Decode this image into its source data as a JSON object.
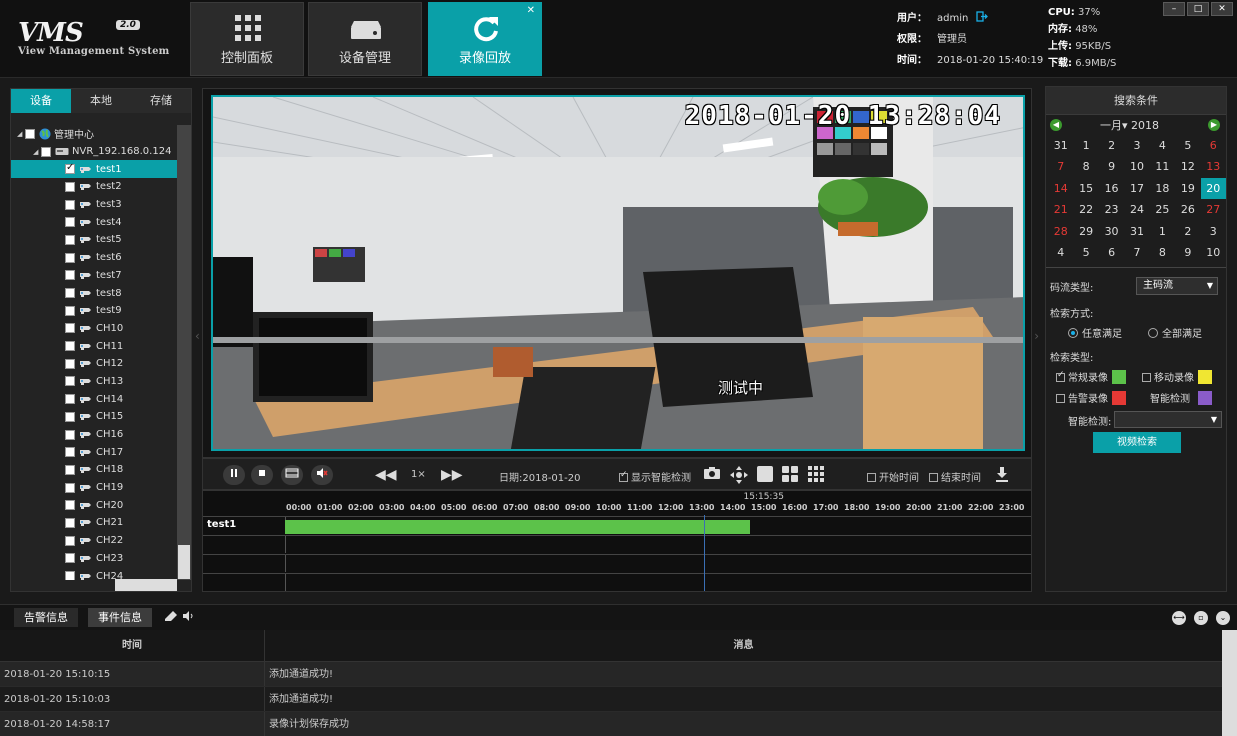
{
  "header": {
    "logo_main": "VMS",
    "logo_version": "2.0",
    "logo_sub": "View Management System",
    "nav": [
      {
        "label": "控制面板",
        "icon": "grid-icon",
        "active": false
      },
      {
        "label": "设备管理",
        "icon": "device-icon",
        "active": false
      },
      {
        "label": "录像回放",
        "icon": "refresh-icon",
        "active": true
      }
    ],
    "close_glyph": "✕",
    "user_label": "用户：",
    "user_value": "admin",
    "perm_label": "权限：",
    "perm_value": "管理员",
    "time_label": "时间：",
    "time_value": "2018-01-20 15:40:19",
    "cpu_label": "CPU:",
    "cpu_value": "37%",
    "mem_label": "内存:",
    "mem_value": "48%",
    "up_label": "上传:",
    "up_value": "95KB/S",
    "down_label": "下载:",
    "down_value": "6.9MB/S",
    "win_buttons": [
      "–",
      "□",
      "✕"
    ]
  },
  "left": {
    "tabs": [
      "设备",
      "本地",
      "存储"
    ],
    "root": "管理中心",
    "nvr": "NVR_192.168.0.124",
    "channels": [
      "test1",
      "test2",
      "test3",
      "test4",
      "test5",
      "test6",
      "test7",
      "test8",
      "test9",
      "CH10",
      "CH11",
      "CH12",
      "CH13",
      "CH14",
      "CH15",
      "CH16",
      "CH17",
      "CH18",
      "CH19",
      "CH20",
      "CH21",
      "CH22",
      "CH23",
      "CH24"
    ],
    "selected": "test1"
  },
  "video": {
    "osd_time": "2018-01-20 13:28:04",
    "osd_text": "测试中"
  },
  "controls": {
    "speed": "1×",
    "date_label": "日期:2018-01-20",
    "show_smart": "显示智能检测",
    "start_time": "开始时间",
    "end_time": "结束时间"
  },
  "timeline": {
    "current": "15:15:35",
    "hours": [
      "00:00",
      "01:00",
      "02:00",
      "03:00",
      "04:00",
      "05:00",
      "06:00",
      "07:00",
      "08:00",
      "09:00",
      "10:00",
      "11:00",
      "12:00",
      "13:00",
      "14:00",
      "15:00",
      "16:00",
      "17:00",
      "18:00",
      "19:00",
      "20:00",
      "21:00",
      "22:00",
      "23:00"
    ],
    "rows": [
      "test1",
      "",
      "",
      ""
    ],
    "record_start_hour": 0,
    "record_end_hour": 15.0,
    "cursor_hour": 13.5
  },
  "search": {
    "title": "搜索条件",
    "month": "一月",
    "year": "2018",
    "days": [
      {
        "d": "31",
        "red": false
      },
      {
        "d": "1",
        "red": false
      },
      {
        "d": "2",
        "red": false
      },
      {
        "d": "3",
        "red": false
      },
      {
        "d": "4",
        "red": false
      },
      {
        "d": "5",
        "red": false
      },
      {
        "d": "6",
        "red": true
      },
      {
        "d": "7",
        "red": true
      },
      {
        "d": "8",
        "red": false
      },
      {
        "d": "9",
        "red": false
      },
      {
        "d": "10",
        "red": false
      },
      {
        "d": "11",
        "red": false
      },
      {
        "d": "12",
        "red": false
      },
      {
        "d": "13",
        "red": true
      },
      {
        "d": "14",
        "red": true
      },
      {
        "d": "15",
        "red": false
      },
      {
        "d": "16",
        "red": false
      },
      {
        "d": "17",
        "red": false
      },
      {
        "d": "18",
        "red": false
      },
      {
        "d": "19",
        "red": false
      },
      {
        "d": "20",
        "red": false,
        "sel": true
      },
      {
        "d": "21",
        "red": true
      },
      {
        "d": "22",
        "red": false
      },
      {
        "d": "23",
        "red": false
      },
      {
        "d": "24",
        "red": false
      },
      {
        "d": "25",
        "red": false
      },
      {
        "d": "26",
        "red": false
      },
      {
        "d": "27",
        "red": true
      },
      {
        "d": "28",
        "red": true
      },
      {
        "d": "29",
        "red": false
      },
      {
        "d": "30",
        "red": false
      },
      {
        "d": "31",
        "red": false
      },
      {
        "d": "1",
        "red": false
      },
      {
        "d": "2",
        "red": false
      },
      {
        "d": "3",
        "red": false
      },
      {
        "d": "4",
        "red": false
      },
      {
        "d": "5",
        "red": false
      },
      {
        "d": "6",
        "red": false
      },
      {
        "d": "7",
        "red": false
      },
      {
        "d": "8",
        "red": false
      },
      {
        "d": "9",
        "red": false
      },
      {
        "d": "10",
        "red": false
      }
    ],
    "stream_label": "码流类型:",
    "stream_value": "主码流",
    "method_label": "检索方式:",
    "method_any": "任意满足",
    "method_all": "全部满足",
    "type_label": "检索类型:",
    "type_normal": "常规录像",
    "type_motion": "移动录像",
    "type_alarm": "告警录像",
    "type_smart": "智能检测",
    "smart_label": "智能检测:",
    "smart_value": "",
    "button": "视频检索",
    "colors": {
      "normal": "#5cc24a",
      "motion": "#f0e632",
      "alarm": "#e53935",
      "smart": "#8a5cc9"
    }
  },
  "bottom": {
    "tab_alarm": "告警信息",
    "tab_event": "事件信息",
    "col_time": "时间",
    "col_msg": "消息",
    "logs": [
      {
        "time": "2018-01-20 15:10:15",
        "msg": "添加通道成功!"
      },
      {
        "time": "2018-01-20 15:10:03",
        "msg": "添加通道成功!"
      },
      {
        "time": "2018-01-20 14:58:17",
        "msg": "录像计划保存成功"
      }
    ]
  }
}
